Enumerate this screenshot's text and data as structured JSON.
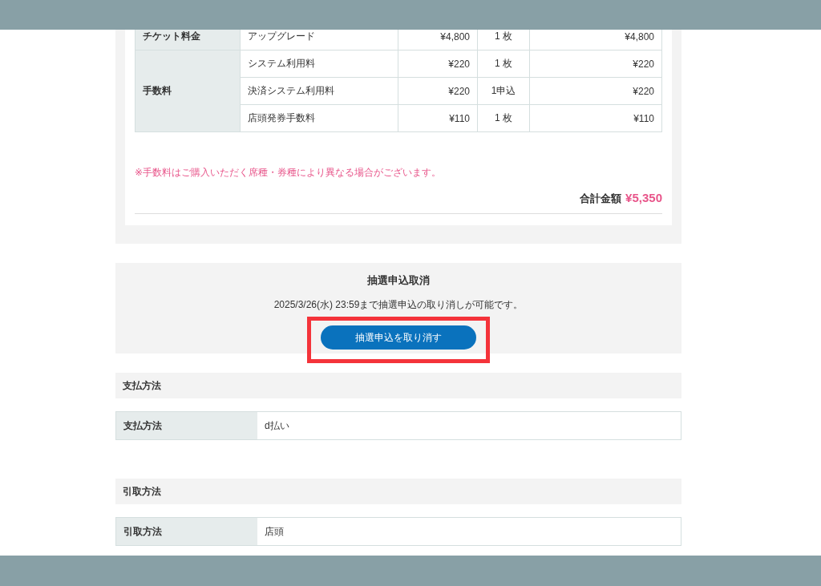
{
  "fee_table": {
    "groups": [
      {
        "label": "チケット料金",
        "rows": [
          {
            "item": "アップグレード",
            "price": "¥4,800",
            "qty": "1 枚",
            "total": "¥4,800"
          }
        ]
      },
      {
        "label": "手数料",
        "rows": [
          {
            "item": "システム利用料",
            "price": "¥220",
            "qty": "1 枚",
            "total": "¥220"
          },
          {
            "item": "決済システム利用料",
            "price": "¥220",
            "qty": "1申込",
            "total": "¥220"
          },
          {
            "item": "店頭発券手数料",
            "price": "¥110",
            "qty": "1 枚",
            "total": "¥110"
          }
        ]
      }
    ]
  },
  "fee_note": "※手数料はご購入いただく席種・券種により異なる場合がございます。",
  "total": {
    "label": "合計金額",
    "value": "¥5,350"
  },
  "cancel": {
    "title": "抽選申込取消",
    "message": "2025/3/26(水) 23:59まで抽選申込の取り消しが可能です。",
    "button": "抽選申込を取り消す",
    "highlighted": true
  },
  "sections": [
    {
      "heading": "支払方法",
      "label": "支払方法",
      "value": "d払い"
    },
    {
      "heading": "引取方法",
      "label": "引取方法",
      "value": "店頭"
    }
  ]
}
